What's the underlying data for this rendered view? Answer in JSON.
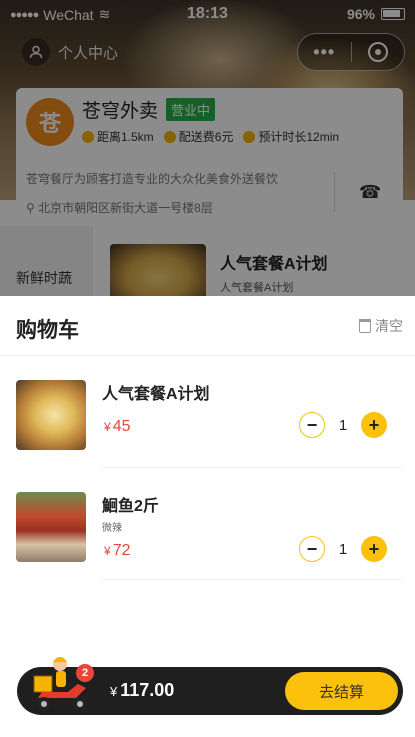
{
  "status_bar": {
    "carrier": "WeChat",
    "time": "18:13",
    "battery": "96%"
  },
  "nav": {
    "user_label": "个人中心",
    "more_label": "•••"
  },
  "shop": {
    "logo_text": "苍",
    "name": "苍穹外卖",
    "status": "营业中",
    "distance": "距离1.5km",
    "delivery_fee": "配送费6元",
    "eta": "预计时长12min",
    "description": "苍穹餐厅为顾客打造专业的大众化美食外送餐饮",
    "address": "北京市朝阳区新街大道一号楼8层"
  },
  "menu": {
    "category": "新鲜时蔬",
    "item_title": "人气套餐A计划",
    "item_sub": "人气套餐A计划"
  },
  "cart": {
    "title": "购物车",
    "clear_label": "清空",
    "items": [
      {
        "name": "人气套餐A计划",
        "spec": "",
        "currency": "¥",
        "price": "45",
        "qty": "1"
      },
      {
        "name": "鮰鱼2斤",
        "spec": "微辣",
        "currency": "¥",
        "price": "72",
        "qty": "1"
      }
    ]
  },
  "cartbar": {
    "badge_count": "2",
    "currency": "¥",
    "total": "117.00",
    "checkout_label": "去结算"
  },
  "colors": {
    "accent": "#fcc10c",
    "price": "#e8453c",
    "open_badge": "#27b04a",
    "bar": "#1f1f1f"
  }
}
